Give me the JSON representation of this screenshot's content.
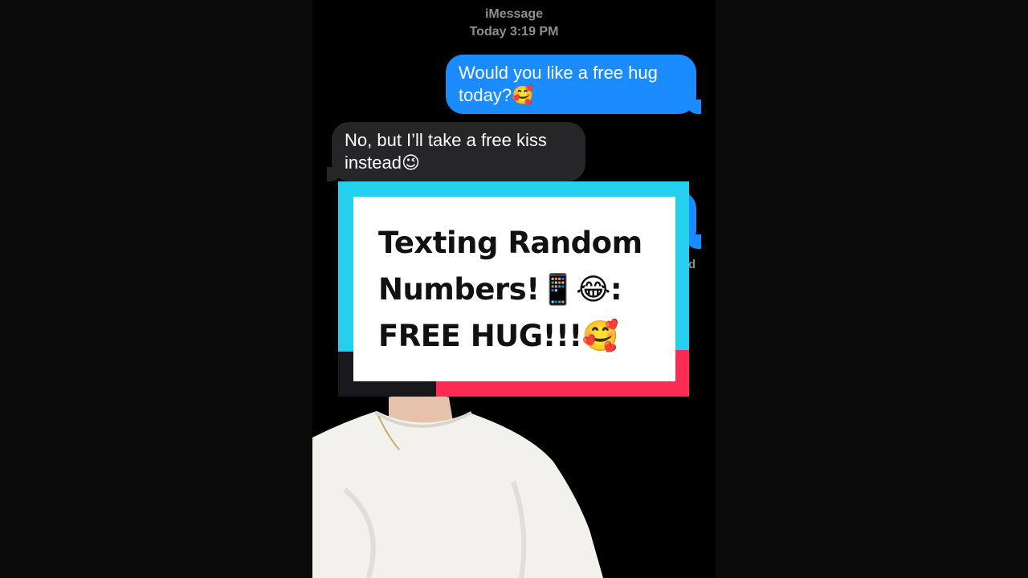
{
  "imessage": {
    "service_label": "iMessage",
    "timestamp": "Today 3:19 PM"
  },
  "messages": [
    {
      "direction": "sent",
      "line1": "Would you like a free hug",
      "line2": "today?🥰"
    },
    {
      "direction": "received",
      "line1": "No, but I’ll take a free kiss",
      "line2": "instead😉"
    }
  ],
  "read_receipt_fragment": "d",
  "overlay": {
    "title_line1": "Texting Random",
    "title_line2": "Numbers!📱😂:",
    "title_line3": "FREE HUG!!!🥰"
  },
  "colors": {
    "sent_bubble": "#1a8cff",
    "received_bubble": "#262628",
    "card_cyan": "#25d0ef",
    "card_red": "#fe2c55"
  }
}
